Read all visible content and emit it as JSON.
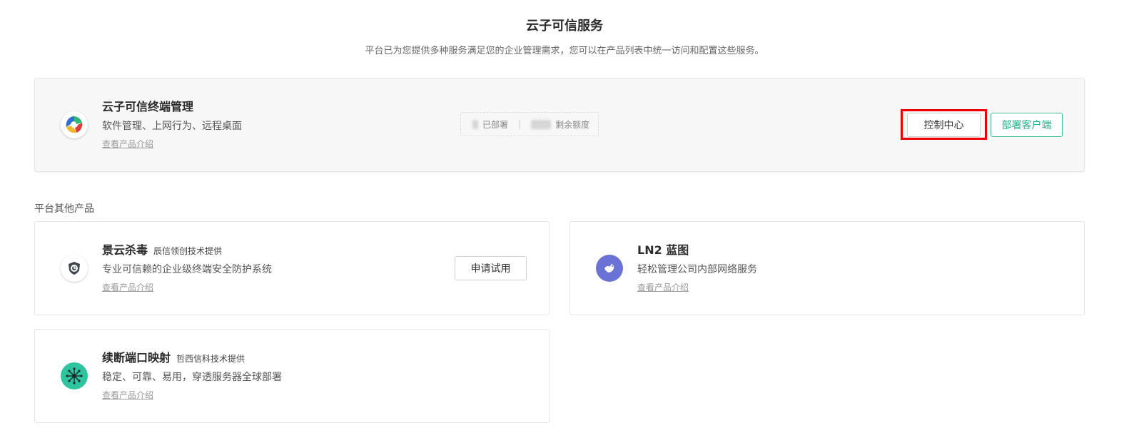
{
  "header": {
    "title": "云子可信服务",
    "subtitle": "平台已为您提供多种服务满足您的企业管理需求，您可以在产品列表中统一访问和配置这些服务。"
  },
  "main_product": {
    "name": "云子可信终端管理",
    "description": "软件管理、上网行为、远程桌面",
    "link": "查看产品介绍",
    "stats": {
      "deployed_label": "已部署",
      "quota_label": "剩余额度",
      "separator": "|"
    },
    "buttons": {
      "control_center": "控制中心",
      "deploy_client": "部署客户端"
    }
  },
  "other_section": {
    "label": "平台其他产品"
  },
  "products": [
    {
      "name": "景云杀毒",
      "provider": "辰信领创技术提供",
      "description": "专业可信赖的企业级终端安全防护系统",
      "link": "查看产品介绍",
      "button": "申请试用"
    },
    {
      "name": "LN2 蓝图",
      "provider": "",
      "description": "轻松管理公司内部网络服务",
      "link": "查看产品介绍"
    },
    {
      "name": "续断端口映射",
      "provider": "哲西信科技术提供",
      "description": "稳定、可靠、易用，穿透服务器全球部署",
      "link": "查看产品介绍"
    }
  ],
  "colors": {
    "accent_green": "#20b08a",
    "highlight_red": "#f00000",
    "ln2_purple": "#6b72d6",
    "port_teal": "#2ec4a0"
  }
}
